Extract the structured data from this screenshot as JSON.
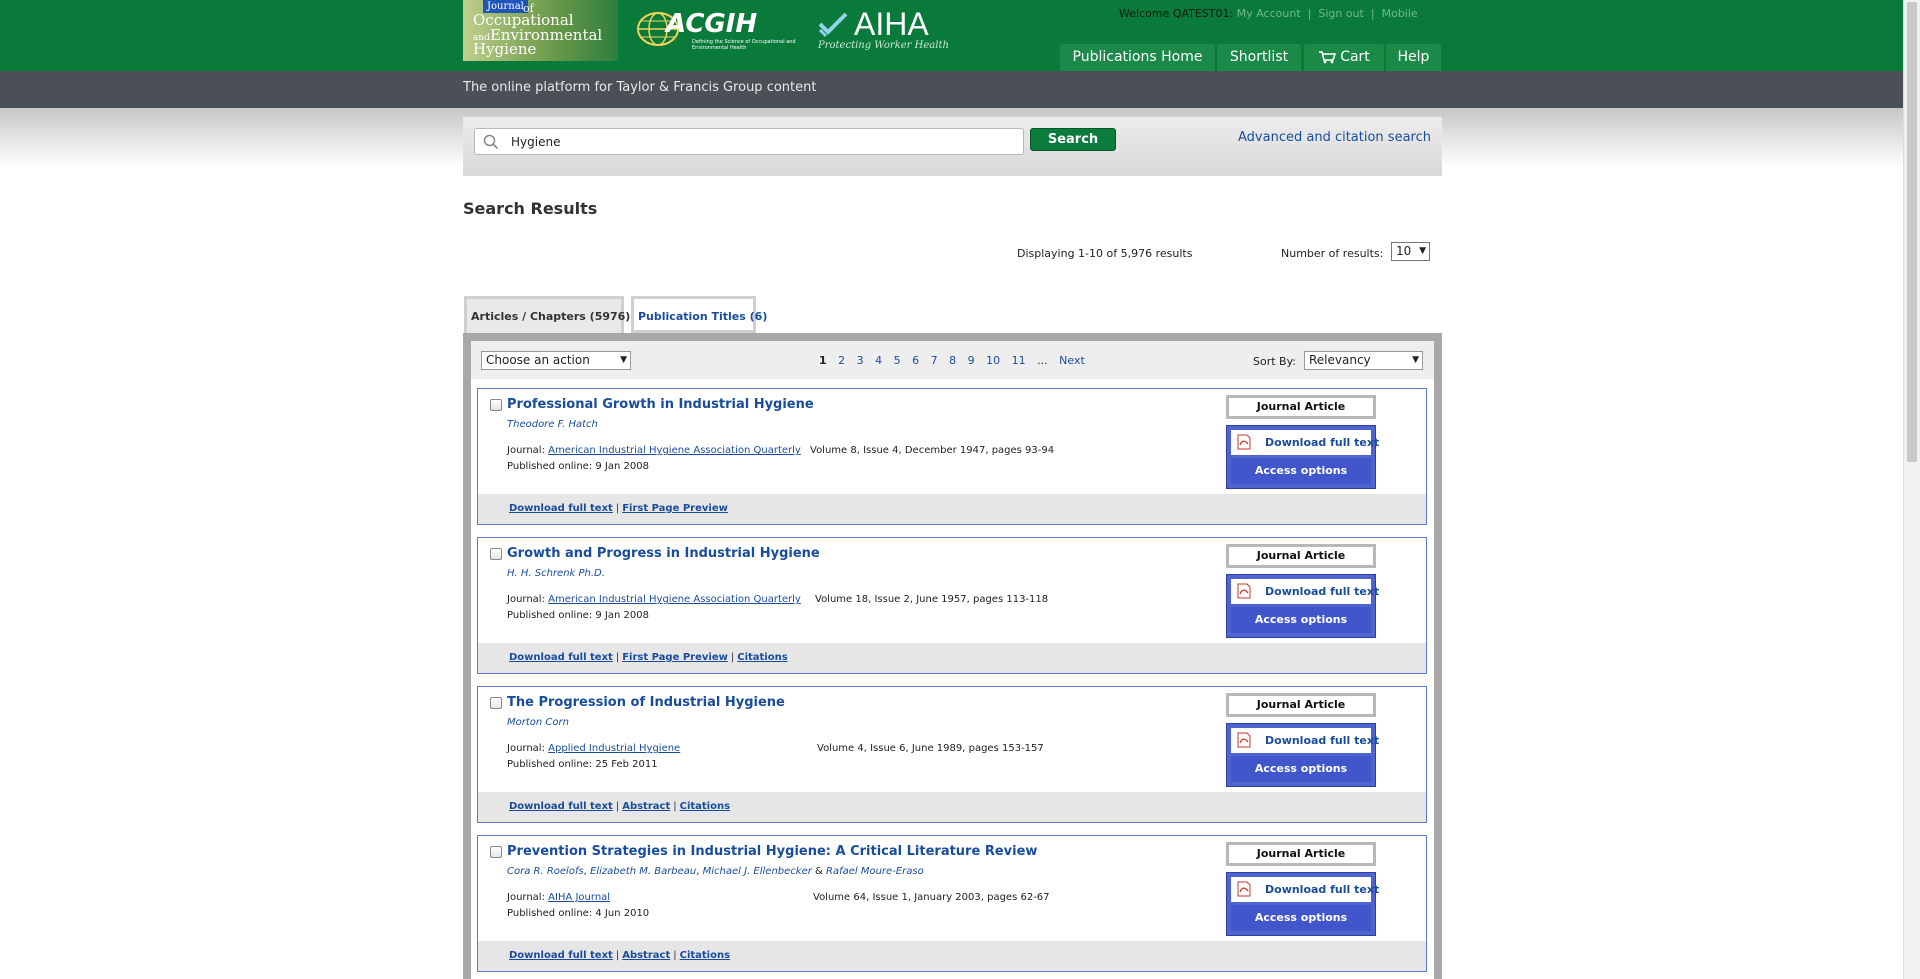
{
  "header": {
    "logo_joeh": {
      "journal": "Journal",
      "of": "of",
      "line1": "Occupational",
      "and": "and",
      "line2": "Environmental",
      "line3": "Hygiene"
    },
    "logo_acgih": {
      "name": "ACGIH",
      "tagline": "Defining the Science of Occupational and Environmental Health"
    },
    "logo_aiha": {
      "name": "AIHA",
      "tagline": "Protecting Worker Health"
    },
    "user": {
      "welcome": "Welcome QATEST01:",
      "my_account": "My Account",
      "sign_out": "Sign out",
      "mobile": "Mobile"
    },
    "nav": {
      "publications_home": "Publications Home",
      "shortlist": "Shortlist",
      "cart": "Cart",
      "help": "Help"
    },
    "tagline": "The online platform for Taylor & Francis Group content",
    "colors": {
      "brand_green": "#0a7a3b",
      "subbar_gray": "#4b5056",
      "link_blue": "#1a4c9c",
      "access_blue": "#5064d0"
    }
  },
  "search": {
    "value": "Hygiene",
    "button": "Search",
    "advanced": "Advanced and citation search"
  },
  "results": {
    "title": "Search Results",
    "displaying": "Displaying 1-10 of 5,976 results",
    "number_label": "Number of results:",
    "number_value": "10",
    "tabs": {
      "articles": "Articles / Chapters (5976)",
      "publication_titles": "Publication Titles (6)"
    },
    "action_select": "Choose an action",
    "pagination": {
      "current": "1",
      "pages": [
        "2",
        "3",
        "4",
        "5",
        "6",
        "7",
        "8",
        "9",
        "10",
        "11"
      ],
      "ellipsis": "...",
      "next": "Next"
    },
    "sort_label": "Sort By:",
    "sort_value": "Relevancy",
    "items": [
      {
        "title": "Professional Growth in Industrial Hygiene",
        "authors": [
          "Theodore F. Hatch"
        ],
        "journal_label": "Journal:",
        "journal": "American Industrial Hygiene Association Quarterly",
        "volume": "Volume 8, Issue 4, December 1947, pages 93-94",
        "published": "Published online: 9 Jan 2008",
        "badge": "Journal Article",
        "download": "Download full text",
        "access": "Access options",
        "links": [
          "Download full text",
          "First Page Preview"
        ]
      },
      {
        "title": "Growth and Progress in Industrial Hygiene",
        "authors": [
          "H. H. Schrenk Ph.D."
        ],
        "journal_label": "Journal:",
        "journal": "American Industrial Hygiene Association Quarterly",
        "volume": "Volume 18, Issue 2, June 1957, pages 113-118",
        "published": "Published online: 9 Jan 2008",
        "badge": "Journal Article",
        "download": "Download full text",
        "access": "Access options",
        "links": [
          "Download full text",
          "First Page Preview",
          "Citations"
        ]
      },
      {
        "title": "The Progression of Industrial Hygiene",
        "authors": [
          "Morton Corn"
        ],
        "journal_label": "Journal:",
        "journal": "Applied Industrial Hygiene",
        "volume": "Volume 4, Issue 6, June 1989, pages 153-157",
        "published": "Published online: 25 Feb 2011",
        "badge": "Journal Article",
        "download": "Download full text",
        "access": "Access options",
        "links": [
          "Download full text",
          "Abstract",
          "Citations"
        ]
      },
      {
        "title": "Prevention Strategies in Industrial Hygiene: A Critical Literature Review",
        "authors": [
          "Cora R. Roelofs",
          "Elizabeth M. Barbeau",
          "Michael J. Ellenbecker",
          "Rafael Moure-Eraso"
        ],
        "journal_label": "Journal:",
        "journal": "AIHA Journal",
        "volume": "Volume 64, Issue 1, January 2003, pages 62-67",
        "published": "Published online: 4 Jun 2010",
        "badge": "Journal Article",
        "download": "Download full text",
        "access": "Access options",
        "links": [
          "Download full text",
          "Abstract",
          "Citations"
        ]
      }
    ]
  }
}
